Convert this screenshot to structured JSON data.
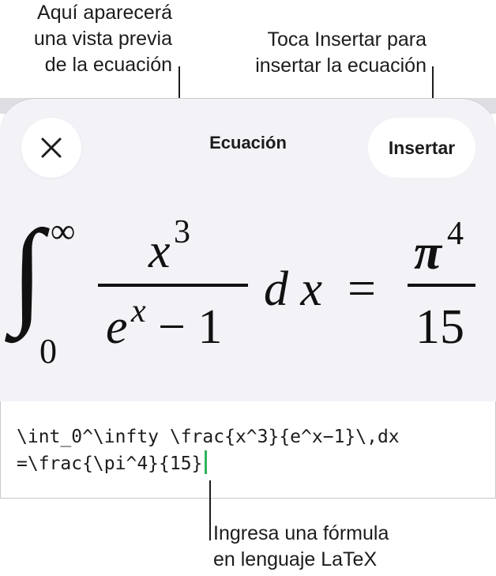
{
  "callouts": {
    "preview": [
      "Aquí aparecerá",
      "una vista previa",
      "de la ecuación"
    ],
    "insert": [
      "Toca Insertar para",
      "insertar la ecuación"
    ],
    "latex": [
      "Ingresa una fórmula",
      "en lenguaje LaTeX"
    ]
  },
  "sheet": {
    "title": "Ecuación",
    "insert_label": "Insertar",
    "close_icon": "close-icon"
  },
  "formula_preview": {
    "integral_sign": "∫",
    "upper_limit": "∞",
    "lower_limit": "0",
    "numerator_base": "x",
    "numerator_exp": "3",
    "denom_base": "e",
    "denom_exp": "x",
    "denom_rest": "− 1",
    "differential": "d x",
    "equals": "=",
    "rhs_num_base": "π",
    "rhs_num_exp": "4",
    "rhs_den": "15"
  },
  "editor": {
    "lines": [
      "\\int_0^\\infty \\frac{x^3}{e^x−1}\\,dx",
      "=\\frac{\\pi^4}{15}"
    ],
    "caret_color": "#2fb35b"
  }
}
